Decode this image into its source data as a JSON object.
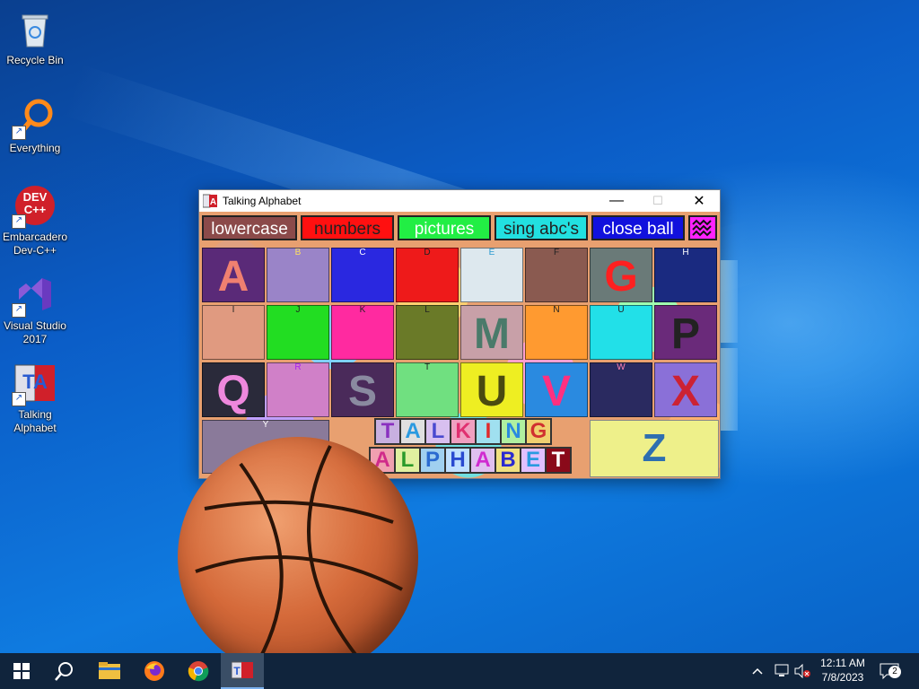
{
  "desktop": {
    "icons": [
      {
        "label": "Recycle Bin",
        "icon": "recycle-bin-icon"
      },
      {
        "label": "Everything",
        "icon": "everything-search-icon"
      },
      {
        "label": "Embarcadero Dev-C++",
        "icon": "devcpp-icon",
        "icon_text": "DEV C++"
      },
      {
        "label": "Visual Studio 2017",
        "icon": "visual-studio-icon"
      },
      {
        "label": "Talking Alphabet",
        "icon": "talking-alphabet-icon",
        "icon_text": "TA"
      }
    ]
  },
  "window": {
    "title": "Talking Alphabet",
    "controls": {
      "minimize": "—",
      "maximize": "☐",
      "close": "✕"
    },
    "toolbar": [
      {
        "label": "lowercase",
        "bg": "#8b4a4a",
        "fg": "#ffffff"
      },
      {
        "label": "numbers",
        "bg": "#ff1010",
        "fg": "#222222"
      },
      {
        "label": "pictures",
        "bg": "#22ee44",
        "fg": "#ffffff"
      },
      {
        "label": "sing abc's",
        "bg": "#22e0e0",
        "fg": "#222222"
      },
      {
        "label": "close ball",
        "bg": "#1111dd",
        "fg": "#ffffff"
      },
      {
        "label": "",
        "bg": "#ff22ff",
        "fg": "#222222",
        "icon": "wave-icon"
      }
    ],
    "letters": [
      {
        "small": "",
        "big": "A",
        "bg": "#5a2a78",
        "fg": "#f08070"
      },
      {
        "small": "B",
        "big": "",
        "bg": "#9a84c8",
        "fg": "#ffe060"
      },
      {
        "small": "C",
        "big": "",
        "bg": "#2a28e0",
        "fg": "#ffffff"
      },
      {
        "small": "D",
        "big": "",
        "bg": "#ee1a1a",
        "fg": "#222222"
      },
      {
        "small": "E",
        "big": "",
        "bg": "#dde8ee",
        "fg": "#2a9ad0"
      },
      {
        "small": "F",
        "big": "",
        "bg": "#8a5a50",
        "fg": "#222222"
      },
      {
        "small": "",
        "big": "G",
        "bg": "#6a7a78",
        "fg": "#ff2020"
      },
      {
        "small": "H",
        "big": "",
        "bg": "#1a2a80",
        "fg": "#ffffff"
      },
      {
        "small": "I",
        "big": "",
        "bg": "#e09a80",
        "fg": "#222222"
      },
      {
        "small": "J",
        "big": "",
        "bg": "#22dd22",
        "fg": "#222222"
      },
      {
        "small": "K",
        "big": "",
        "bg": "#ff2aa0",
        "fg": "#222222"
      },
      {
        "small": "L",
        "big": "",
        "bg": "#6a7a28",
        "fg": "#222222"
      },
      {
        "small": "",
        "big": "M",
        "bg": "#c8a0a8",
        "fg": "#4a7a6a"
      },
      {
        "small": "N",
        "big": "",
        "bg": "#ff9a30",
        "fg": "#222222"
      },
      {
        "small": "U",
        "big": "",
        "bg": "#22e0e8",
        "fg": "#222222"
      },
      {
        "small": "",
        "big": "P",
        "bg": "#6a2a7a",
        "fg": "#222222"
      },
      {
        "small": "",
        "big": "Q",
        "bg": "#2a2a3a",
        "fg": "#ee88dd"
      },
      {
        "small": "R",
        "big": "",
        "bg": "#d080c8",
        "fg": "#aa22ee"
      },
      {
        "small": "",
        "big": "S",
        "bg": "#4a2a5a",
        "fg": "#8a8aa0"
      },
      {
        "small": "T",
        "big": "",
        "bg": "#70e080",
        "fg": "#222222"
      },
      {
        "small": "",
        "big": "U",
        "bg": "#eeee22",
        "fg": "#4a4a10"
      },
      {
        "small": "",
        "big": "V",
        "bg": "#2a8ae0",
        "fg": "#ff3080"
      },
      {
        "small": "W",
        "big": "",
        "bg": "#2a2a60",
        "fg": "#ff80b0"
      },
      {
        "small": "",
        "big": "X",
        "bg": "#8a70d8",
        "fg": "#cc2233"
      },
      {
        "small": "Y",
        "big": "",
        "bg": "#8a7a9a",
        "fg": "#ffffff"
      }
    ],
    "logo_top": [
      "T",
      "A",
      "L",
      "K",
      "I",
      "N",
      "G"
    ],
    "logo_bottom": [
      "A",
      "L",
      "P",
      "H",
      "A",
      "B",
      "E",
      "T"
    ],
    "z_letter": "Z"
  },
  "taskbar": {
    "items": [
      "start-icon",
      "search-icon",
      "file-explorer-icon",
      "firefox-icon",
      "chrome-icon",
      "talking-alphabet-taskbar-icon"
    ],
    "time": "12:11 AM",
    "date": "7/8/2023",
    "notifications": "2"
  }
}
